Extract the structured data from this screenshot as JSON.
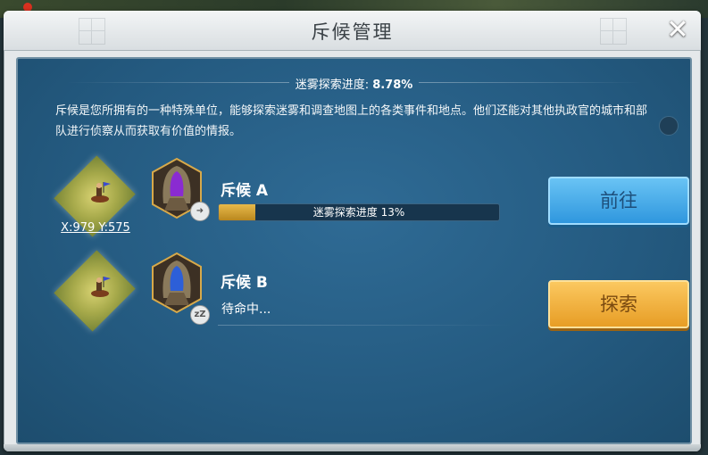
{
  "window": {
    "title": "斥候管理",
    "close_glyph": "✕"
  },
  "fog": {
    "label": "迷雾探索进度: ",
    "value": "8.78%"
  },
  "description": "斥候是您所拥有的一种特殊单位，能够探索迷雾和调查地图上的各类事件和地点。他们还能对其他执政官的城市和部队进行侦察从而获取有价值的情报。",
  "scouts": [
    {
      "name": "斥候 A",
      "coords": "X:979 Y:575",
      "progress_label": "迷雾探索进度 13%",
      "progress": 0.13,
      "status_icon": "marching-icon",
      "hood_color": "#8a2bd1",
      "action_label": "前往"
    },
    {
      "name": "斥候 B",
      "status_text": "待命中...",
      "status_icon": "sleep-icon",
      "status_glyph": "zZ",
      "hood_color": "#2d5fd8",
      "action_label": "探索"
    }
  ]
}
